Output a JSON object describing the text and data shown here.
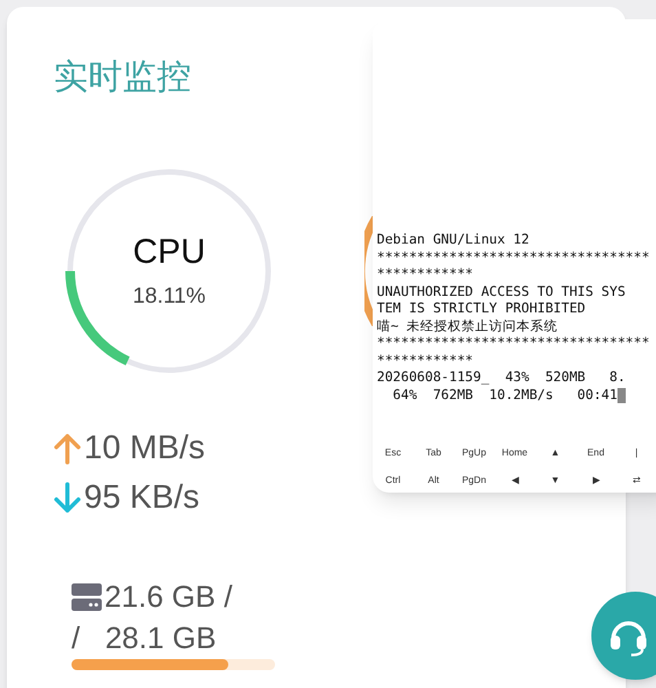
{
  "title": "实时监控",
  "cpu": {
    "label": "CPU",
    "reading": "18.11%",
    "level": 0.1811
  },
  "network": {
    "upload": "10 MB/s",
    "download": "95 KB/s"
  },
  "disk": {
    "line_1": "21.6 GB /",
    "line_2": "/   28.1 GB",
    "level": 0.77
  },
  "terminal": {
    "lines": [
      "Debian GNU/Linux 12",
      "**********************************",
      "************",
      "UNAUTHORIZED ACCESS TO THIS SYS",
      "TEM IS STRICTLY PROHIBITED",
      "喵~ 未经授权禁止访问本系统",
      "**********************************",
      "************",
      "20260608-1159_  43%  520MB   8.",
      "  64%  762MB  10.2MB/s   00:41"
    ],
    "keys": [
      [
        "Esc",
        "Tab",
        "PgUp",
        "Home",
        "▲",
        "End",
        "|"
      ],
      [
        "Ctrl",
        "Alt",
        "PgDn",
        "◀",
        "▼",
        "▶",
        "⇄"
      ]
    ]
  }
}
